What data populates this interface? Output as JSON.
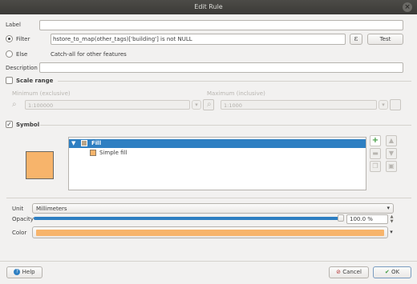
{
  "window": {
    "title": "Edit Rule",
    "close_glyph": "×"
  },
  "label_row": {
    "label": "Label",
    "value": ""
  },
  "filter_row": {
    "label": "Filter",
    "expression": "hstore_to_map(other_tags)['building'] is not NULL",
    "expression_button": "ε",
    "test_button": "Test",
    "selected": true
  },
  "else_row": {
    "label": "Else",
    "description": "Catch-all for other features",
    "selected": false
  },
  "description_row": {
    "label": "Description",
    "value": ""
  },
  "scale_range": {
    "label": "Scale range",
    "checked": false,
    "minimum_label": "Minimum (exclusive)",
    "minimum_value": "1:100000",
    "maximum_label": "Maximum (inclusive)",
    "maximum_value": "1:1000"
  },
  "symbol": {
    "label": "Symbol",
    "checked": true,
    "check_glyph": "✓",
    "swatch_color": "#f7b46b",
    "tree": [
      {
        "label": "Fill",
        "selected": true
      },
      {
        "label": "Simple fill",
        "selected": false
      }
    ],
    "side_buttons": [
      "add-layer",
      "remove-layer",
      "duplicate-layer",
      "move-up",
      "move-down",
      "lock-layer"
    ],
    "add_glyph": "+"
  },
  "properties": {
    "unit_label": "Unit",
    "unit_value": "Millimeters",
    "opacity_label": "Opacity",
    "opacity_value": "100.0 %",
    "opacity_fraction": 1.0,
    "color_label": "Color",
    "color_value": "#f7b46b"
  },
  "footer": {
    "help": "Help",
    "cancel": "Cancel",
    "ok": "OK"
  }
}
